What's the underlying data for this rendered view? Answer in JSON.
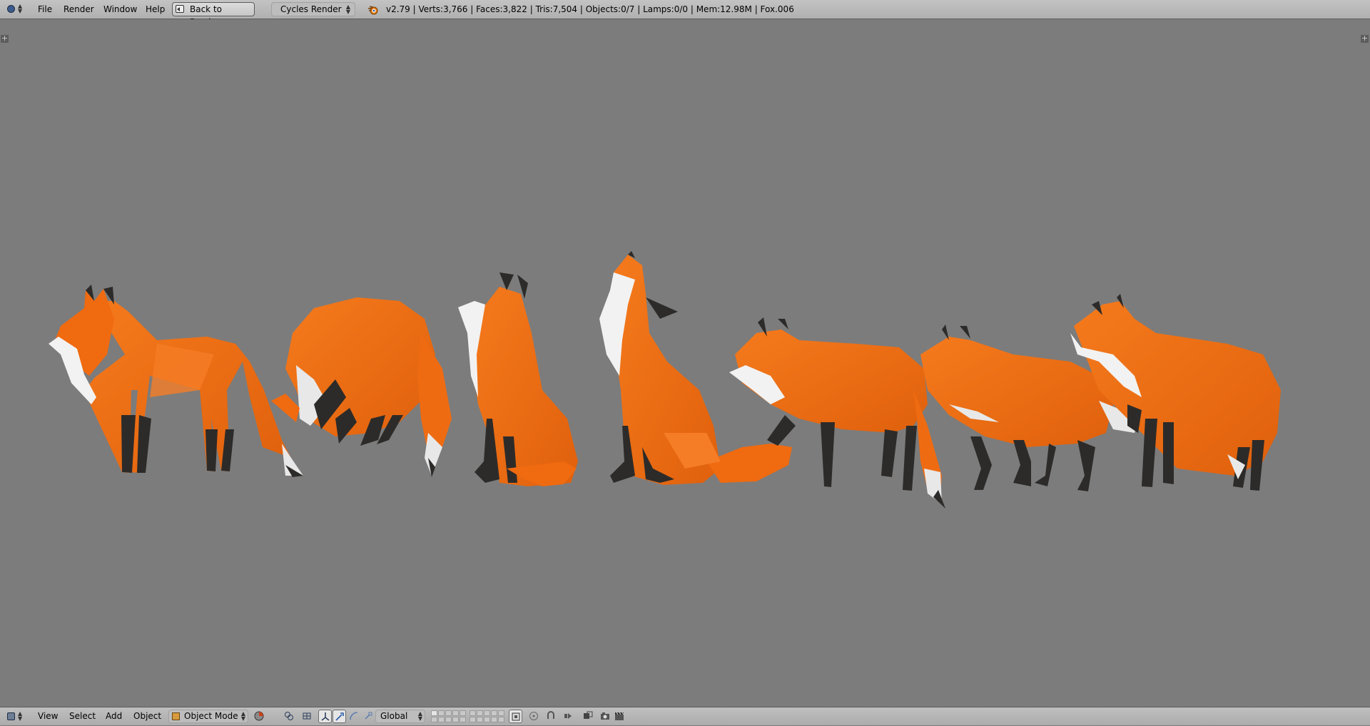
{
  "top_header": {
    "editor_type_icon": "info-icon",
    "menus": [
      "File",
      "Render",
      "Window",
      "Help"
    ],
    "back_button_label": "Back to Previous",
    "render_engine": "Cycles Render",
    "logo_icon": "blender-logo-icon",
    "stats": "v2.79 | Verts:3,766 | Faces:3,822 | Tris:7,504 | Objects:0/7 | Lamps:0/0 | Mem:12.98M | Fox.006"
  },
  "viewport": {
    "background_color": "#7c7c7c",
    "fox_color": "#f06a10",
    "scene_objects": [
      "fox-standing",
      "fox-pouncing",
      "fox-sitting",
      "fox-howling",
      "fox-walking",
      "fox-trotting",
      "fox-looking-back"
    ]
  },
  "bottom_header": {
    "editor_type_icon": "3d-view-icon",
    "menus": [
      "View",
      "Select",
      "Add",
      "Object"
    ],
    "mode": "Object Mode",
    "shading_icon": "viewport-shading-icon",
    "pivot_icon": "pivot-point-icon",
    "manipulator_icons": [
      "manipulator-toggle-icon",
      "translate-icon",
      "rotate-icon",
      "scale-icon"
    ],
    "orientation": "Global",
    "layers_icon": "layers-icon",
    "right_icons": [
      "lock-camera-icon",
      "proportional-edit-icon",
      "snap-icon",
      "snap-target-icon",
      "render-preview-icon",
      "opengl-render-icon",
      "opengl-animation-icon"
    ]
  }
}
